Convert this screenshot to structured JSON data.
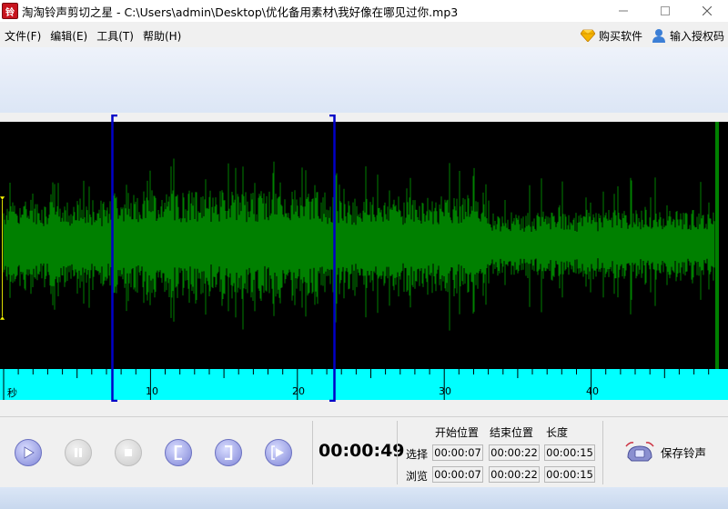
{
  "window": {
    "title": "淘淘铃声剪切之星 - C:\\Users\\admin\\Desktop\\优化备用素材\\我好像在哪见过你.mp3",
    "app_icon_glyph": "铃",
    "controls": [
      "minimize-icon",
      "maximize-icon",
      "close-icon"
    ]
  },
  "menu": {
    "items": [
      "文件(F)",
      "编辑(E)",
      "工具(T)",
      "帮助(H)"
    ],
    "buy": "购买软件",
    "license": "输入授权码"
  },
  "timeline": {
    "unit_label": "秒",
    "tick_labels": [
      "10",
      "20",
      "30",
      "40"
    ],
    "selection_start_sec": 7,
    "selection_end_sec": 22,
    "colors": {
      "wave": "#008000",
      "ruler": "#00ffff",
      "selection": "#0000c8",
      "marker": "#ffff00"
    }
  },
  "transport": {
    "buttons": [
      "play-icon",
      "pause-icon",
      "stop-icon",
      "set-start-icon",
      "set-end-icon",
      "preview-icon"
    ],
    "current_time": "00:00:49"
  },
  "position_table": {
    "headers": [
      "开始位置",
      "结束位置",
      "长度"
    ],
    "rows": [
      {
        "label": "选择",
        "start": "00:00:07",
        "end": "00:00:22",
        "length": "00:00:15"
      },
      {
        "label": "浏览",
        "start": "00:00:07",
        "end": "00:00:22",
        "length": "00:00:15"
      }
    ]
  },
  "save_button": {
    "label": "保存铃声"
  }
}
